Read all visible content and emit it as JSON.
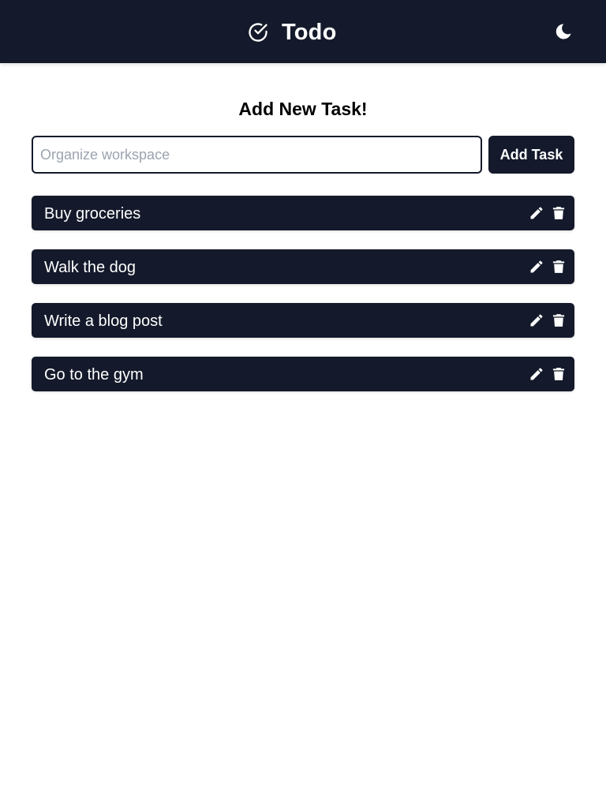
{
  "header": {
    "title": "Todo",
    "brand_icon": "check-circle-icon",
    "theme_icon": "moon-icon"
  },
  "form": {
    "heading": "Add New Task!",
    "input_value": "",
    "input_placeholder": "Organize workspace",
    "add_label": "Add Task"
  },
  "tasks": [
    {
      "label": "Buy groceries"
    },
    {
      "label": "Walk the dog"
    },
    {
      "label": "Write a blog post"
    },
    {
      "label": "Go to the gym"
    }
  ],
  "task_action_icons": [
    "pencil-icon",
    "trash-icon"
  ],
  "colors": {
    "primary_dark": "#141a2b",
    "on_primary": "#ffffff",
    "placeholder": "#9ca3af",
    "background": "#ffffff"
  }
}
